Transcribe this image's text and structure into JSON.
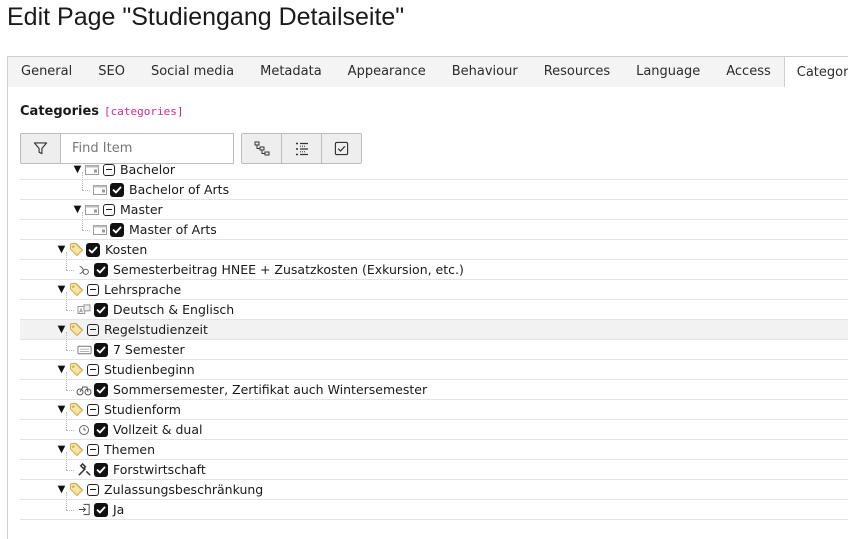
{
  "page": {
    "title": "Edit Page \"Studiengang Detailseite\""
  },
  "tabs": [
    {
      "label": "General",
      "active": false
    },
    {
      "label": "SEO",
      "active": false
    },
    {
      "label": "Social media",
      "active": false
    },
    {
      "label": "Metadata",
      "active": false
    },
    {
      "label": "Appearance",
      "active": false
    },
    {
      "label": "Behaviour",
      "active": false
    },
    {
      "label": "Resources",
      "active": false
    },
    {
      "label": "Language",
      "active": false
    },
    {
      "label": "Access",
      "active": false
    },
    {
      "label": "Categories",
      "active": true
    }
  ],
  "field": {
    "label": "Categories",
    "code": "[categories]"
  },
  "toolbar": {
    "filter_icon": "filter-icon",
    "search_placeholder": "Find Item",
    "buttons": [
      "tree-expand-icon",
      "list-icon",
      "checkbox-icon"
    ]
  },
  "tree": {
    "rows": [
      {
        "level": 2,
        "label": "Bachelor",
        "state": "partial",
        "icon": "folder-icon",
        "caret": true
      },
      {
        "level": 3,
        "label": "Bachelor of Arts",
        "state": "checked",
        "icon": "folder-icon",
        "caret": false
      },
      {
        "level": 2,
        "label": "Master",
        "state": "partial",
        "icon": "folder-icon",
        "caret": true
      },
      {
        "level": 3,
        "label": "Master of Arts",
        "state": "checked",
        "icon": "folder-icon",
        "caret": false
      },
      {
        "level": 1,
        "label": "Kosten",
        "state": "checked",
        "icon": "tag-icon",
        "caret": true
      },
      {
        "level": 2,
        "label": "Semesterbeitrag HNEE + Zusatzkosten (Exkursion, etc.)",
        "state": "checked",
        "icon": "coins-icon",
        "caret": false
      },
      {
        "level": 1,
        "label": "Lehrsprache",
        "state": "partial",
        "icon": "tag-icon",
        "caret": true
      },
      {
        "level": 2,
        "label": "Deutsch & Englisch",
        "state": "checked",
        "icon": "language-icon",
        "caret": false
      },
      {
        "level": 1,
        "label": "Regelstudienzeit",
        "state": "partial",
        "icon": "tag-icon",
        "caret": true,
        "highlight": true
      },
      {
        "level": 2,
        "label": "7 Semester",
        "state": "checked",
        "icon": "calendar-icon",
        "caret": false
      },
      {
        "level": 1,
        "label": "Studienbeginn",
        "state": "partial",
        "icon": "tag-icon",
        "caret": true
      },
      {
        "level": 2,
        "label": "Sommersemester, Zertifikat auch Wintersemester",
        "state": "checked",
        "icon": "bicycle-icon",
        "caret": false
      },
      {
        "level": 1,
        "label": "Studienform",
        "state": "partial",
        "icon": "tag-icon",
        "caret": true
      },
      {
        "level": 2,
        "label": "Vollzeit & dual",
        "state": "checked",
        "icon": "clock-icon",
        "caret": false
      },
      {
        "level": 1,
        "label": "Themen",
        "state": "partial",
        "icon": "tag-icon",
        "caret": true
      },
      {
        "level": 2,
        "label": "Forstwirtschaft",
        "state": "checked",
        "icon": "tools-icon",
        "caret": false
      },
      {
        "level": 1,
        "label": "Zulassungsbeschränkung",
        "state": "partial",
        "icon": "tag-icon",
        "caret": true
      },
      {
        "level": 2,
        "label": "Ja",
        "state": "checked",
        "icon": "login-icon",
        "caret": false
      }
    ]
  }
}
